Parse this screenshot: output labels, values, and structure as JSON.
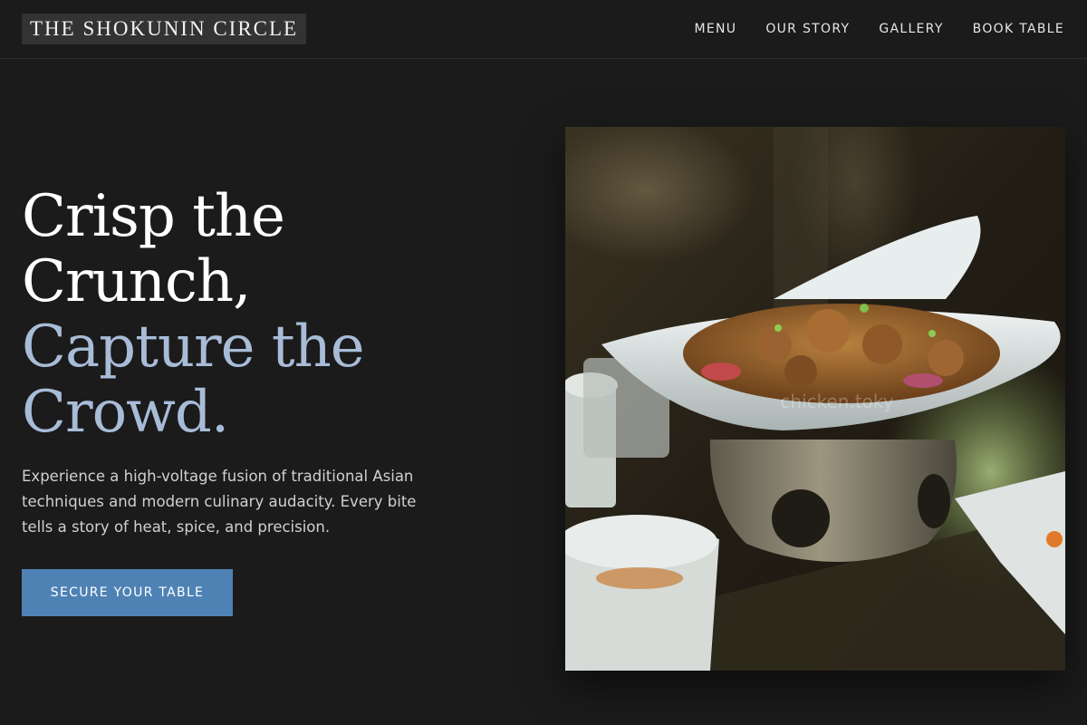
{
  "brand": {
    "name": "THE SHOKUNIN CIRCLE"
  },
  "nav": {
    "items": [
      {
        "label": "MENU"
      },
      {
        "label": "OUR STORY"
      },
      {
        "label": "GALLERY"
      },
      {
        "label": "BOOK TABLE"
      }
    ]
  },
  "hero": {
    "headline_lines": [
      "Crisp the",
      "Crunch,",
      "Capture the",
      "Crowd."
    ],
    "lead": "Experience a high-voltage fusion of traditional Asian techniques and modern culinary audacity. Every bite tells a story of heat, spice, and precision.",
    "cta_label": "SECURE YOUR TABLE",
    "photo_watermark": "chicken.toky",
    "accent_color": "#a8bcd8",
    "button_color": "#4e82b4"
  }
}
